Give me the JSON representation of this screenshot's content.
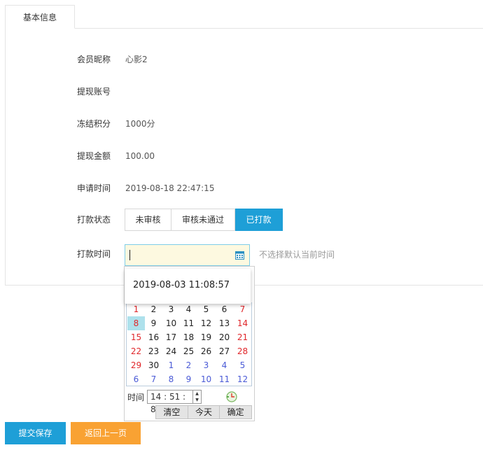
{
  "tab": {
    "label": "基本信息"
  },
  "fields": [
    {
      "label": "会员昵称",
      "value": "心影2"
    },
    {
      "label": "提现账号",
      "value": ""
    },
    {
      "label": "冻结积分",
      "value": "1000分"
    },
    {
      "label": "提现金额",
      "value": "100.00"
    },
    {
      "label": "申请时间",
      "value": "2019-08-18 22:47:15"
    }
  ],
  "pay_status": {
    "label": "打款状态",
    "options": [
      "未审核",
      "审核未通过",
      "已打款"
    ],
    "selected": "已打款"
  },
  "pay_time": {
    "label": "打款时间",
    "value": "",
    "hint": "不选择默认当前时间"
  },
  "datepicker": {
    "suggestion": "2019-08-03 11:08:57",
    "weeks": [
      [
        "1",
        "2",
        "3",
        "4",
        "5",
        "6",
        "7"
      ],
      [
        "8",
        "9",
        "10",
        "11",
        "12",
        "13",
        "14"
      ],
      [
        "15",
        "16",
        "17",
        "18",
        "19",
        "20",
        "21"
      ],
      [
        "22",
        "23",
        "24",
        "25",
        "26",
        "27",
        "28"
      ],
      [
        "29",
        "30",
        "1",
        "2",
        "3",
        "4",
        "5"
      ],
      [
        "6",
        "7",
        "8",
        "9",
        "10",
        "11",
        "12"
      ]
    ],
    "selected_day": "8",
    "time_label": "时间",
    "time_value": "14 : 51 : 8",
    "buttons": {
      "clear": "清空",
      "today": "今天",
      "ok": "确定"
    }
  },
  "actions": {
    "submit": "提交保存",
    "back": "返回上一页"
  },
  "colors": {
    "primary": "#1e9fd7",
    "orange": "#f9a233",
    "weekend": "#e0262a",
    "other_month": "#4a5ad6"
  }
}
